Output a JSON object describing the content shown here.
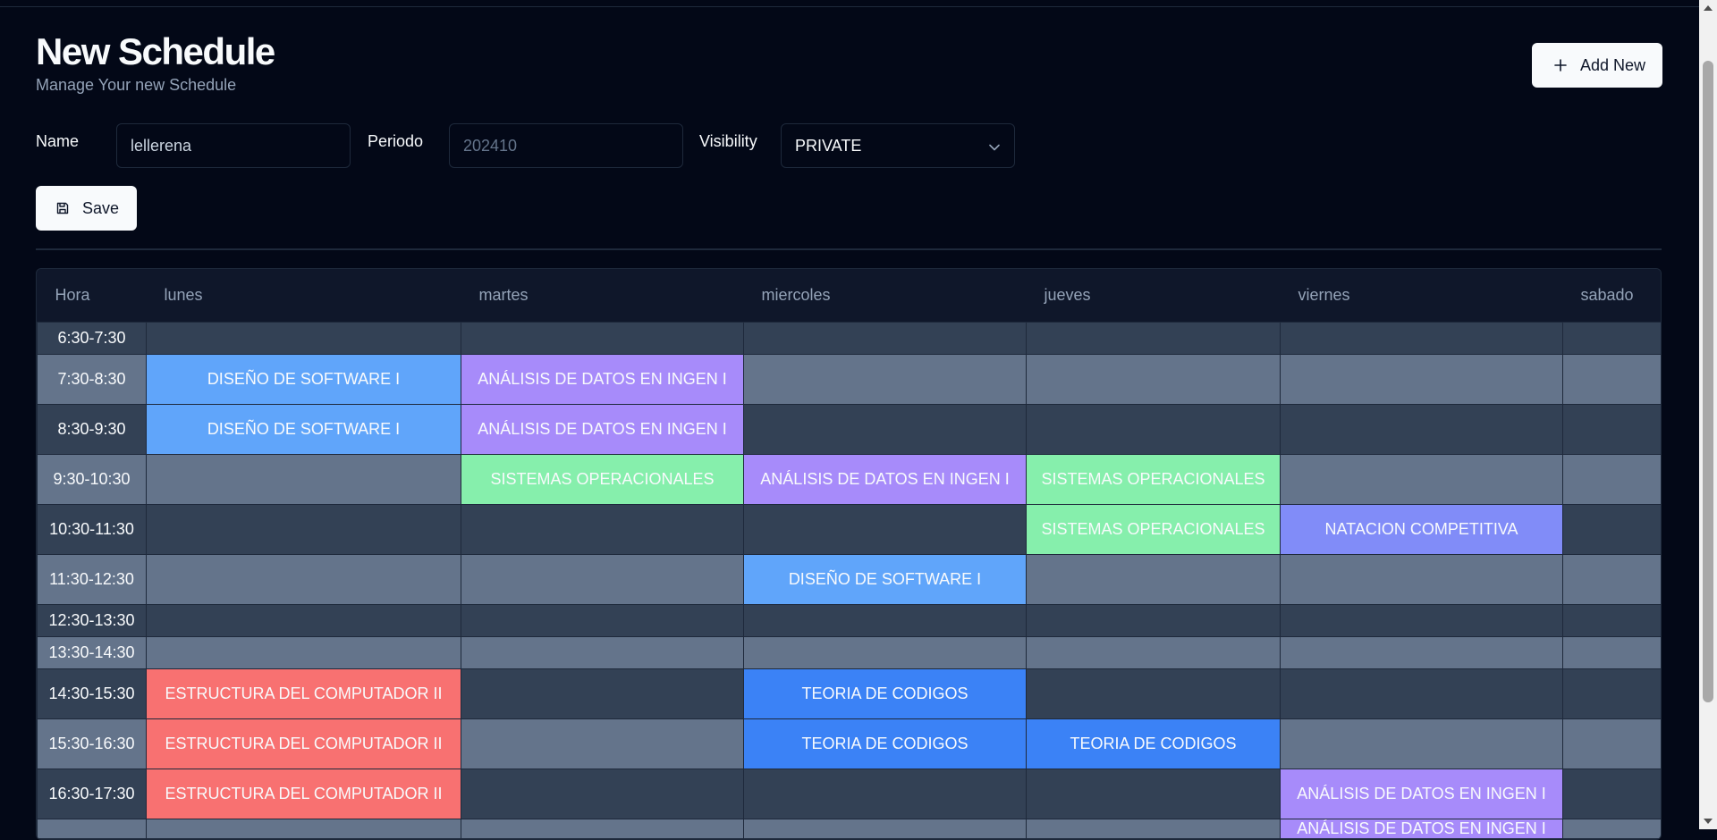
{
  "header": {
    "title": "New Schedule",
    "subtitle": "Manage Your new Schedule",
    "add_label": "Add New",
    "add_icon": "plus-icon"
  },
  "form": {
    "name_label": "Name",
    "name_value": "lellerena",
    "periodo_label": "Periodo",
    "periodo_placeholder": "202410",
    "visibility_label": "Visibility",
    "visibility_value": "PRIVATE",
    "save_label": "Save",
    "save_icon": "save-icon"
  },
  "schedule": {
    "columns": [
      "Hora",
      "lunes",
      "martes",
      "miercoles",
      "jueves",
      "viernes",
      "sabado"
    ],
    "rows": [
      {
        "hora": "6:30-7:30",
        "cells": [
          "",
          "",
          "",
          "",
          "",
          ""
        ]
      },
      {
        "hora": "7:30-8:30",
        "cells": [
          "DISEÑO DE SOFTWARE I",
          "ANÁLISIS DE DATOS EN INGEN I",
          "",
          "",
          "",
          ""
        ]
      },
      {
        "hora": "8:30-9:30",
        "cells": [
          "DISEÑO DE SOFTWARE I",
          "ANÁLISIS DE DATOS EN INGEN I",
          "",
          "",
          "",
          ""
        ]
      },
      {
        "hora": "9:30-10:30",
        "cells": [
          "",
          "SISTEMAS OPERACIONALES",
          "ANÁLISIS DE DATOS EN INGEN I",
          "SISTEMAS OPERACIONALES",
          "",
          ""
        ]
      },
      {
        "hora": "10:30-11:30",
        "cells": [
          "",
          "",
          "",
          "SISTEMAS OPERACIONALES",
          "NATACION COMPETITIVA",
          ""
        ]
      },
      {
        "hora": "11:30-12:30",
        "cells": [
          "",
          "",
          "DISEÑO DE SOFTWARE I",
          "",
          "",
          ""
        ]
      },
      {
        "hora": "12:30-13:30",
        "cells": [
          "",
          "",
          "",
          "",
          "",
          ""
        ]
      },
      {
        "hora": "13:30-14:30",
        "cells": [
          "",
          "",
          "",
          "",
          "",
          ""
        ]
      },
      {
        "hora": "14:30-15:30",
        "cells": [
          "ESTRUCTURA DEL COMPUTADOR II",
          "",
          "TEORIA DE CODIGOS",
          "",
          "",
          ""
        ]
      },
      {
        "hora": "15:30-16:30",
        "cells": [
          "ESTRUCTURA DEL COMPUTADOR II",
          "",
          "TEORIA DE CODIGOS",
          "TEORIA DE CODIGOS",
          "",
          ""
        ]
      },
      {
        "hora": "16:30-17:30",
        "cells": [
          "ESTRUCTURA DEL COMPUTADOR II",
          "",
          "",
          "",
          "ANÁLISIS DE DATOS EN INGEN I",
          ""
        ]
      },
      {
        "hora": "",
        "cells": [
          "",
          "",
          "",
          "",
          "ANÁLISIS DE DATOS EN INGEN I",
          ""
        ]
      }
    ]
  },
  "course_colors": {
    "DISEÑO DE SOFTWARE I": "#60a5fa",
    "ANÁLISIS DE DATOS EN INGEN I": "#a78bfa",
    "SISTEMAS OPERACIONALES": "#86efac",
    "NATACION COMPETITIVA": "#818cf8",
    "ESTRUCTURA DEL COMPUTADOR II": "#f87171",
    "TEORIA DE CODIGOS": "#3b82f6"
  }
}
